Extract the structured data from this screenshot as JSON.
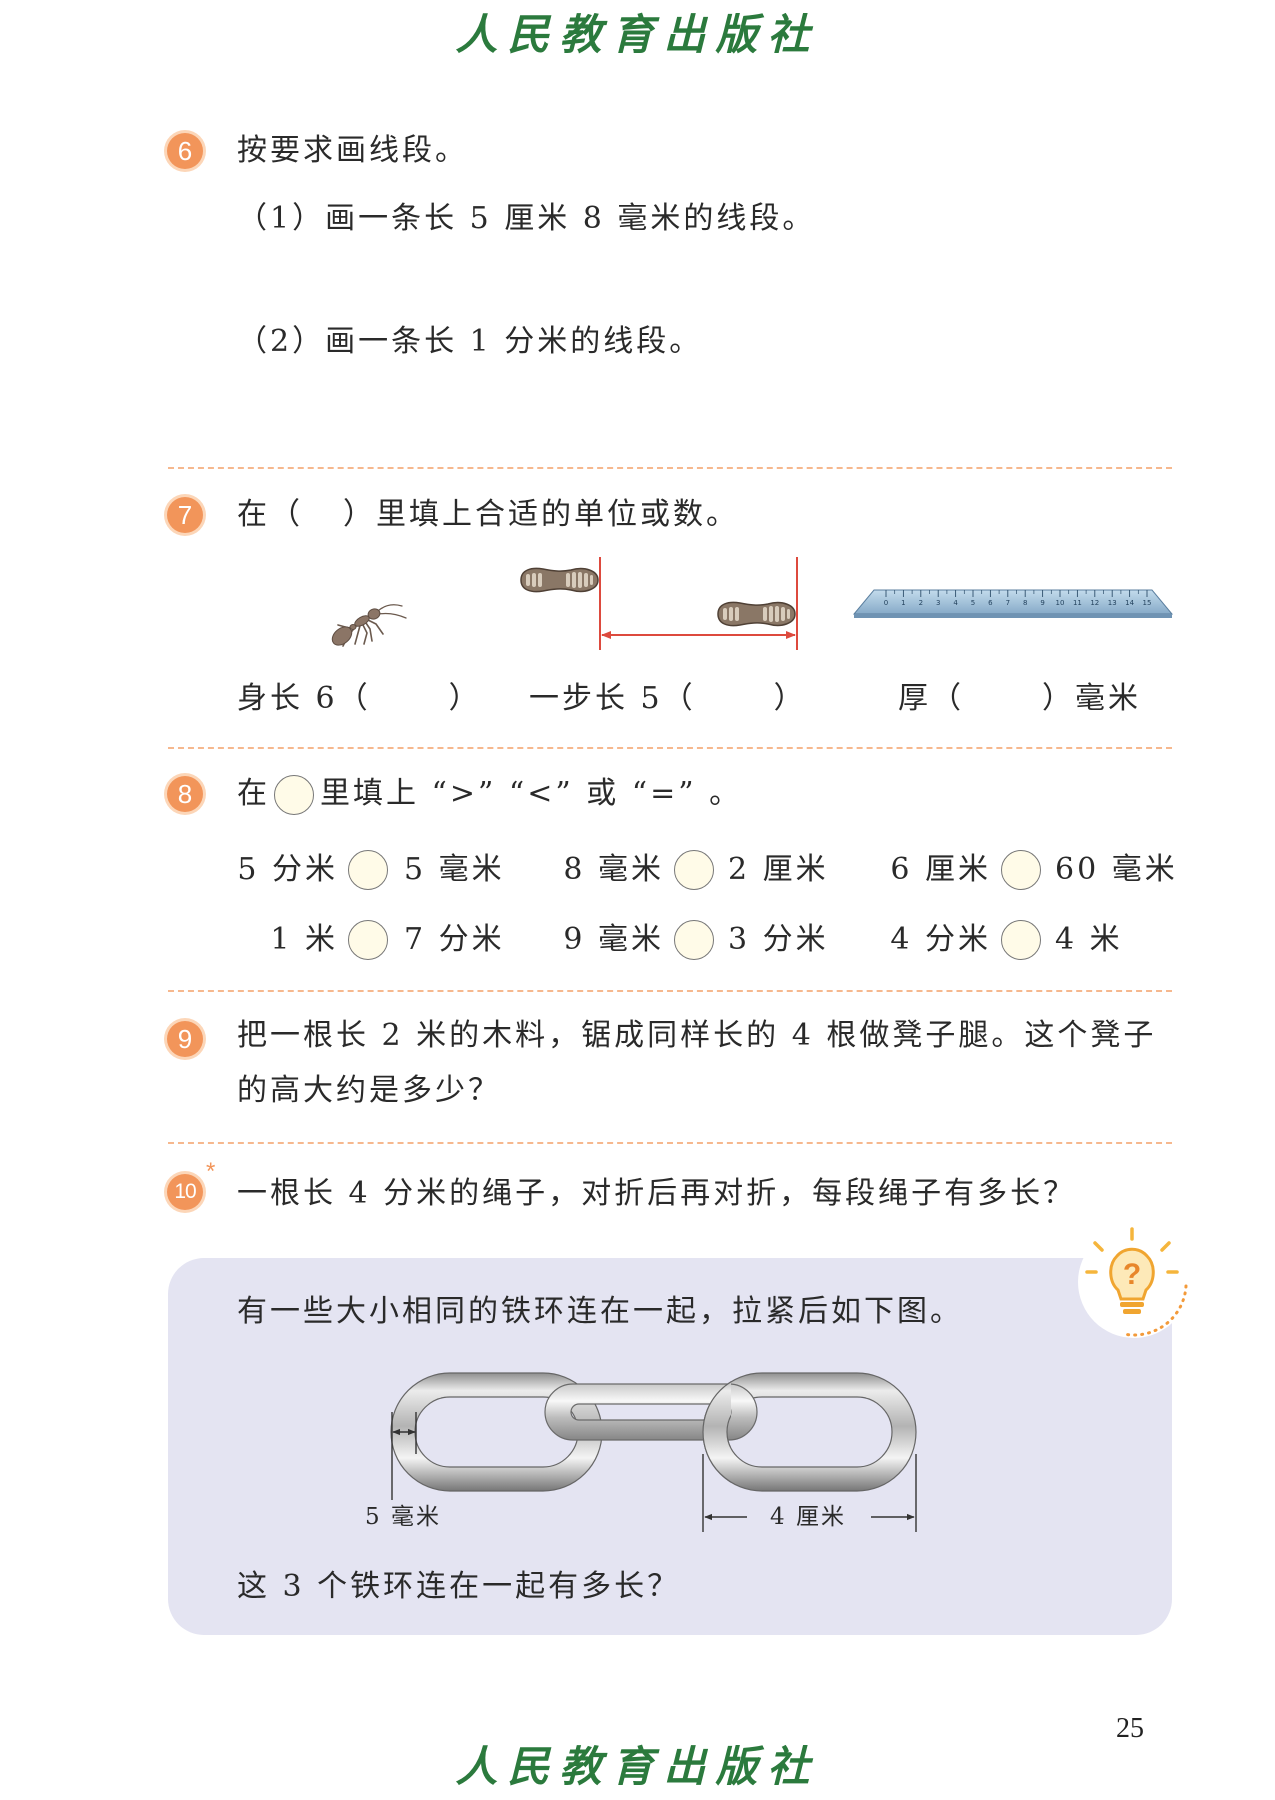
{
  "colors": {
    "accent": "#f2955a",
    "accent_ring": "#fcd6b8",
    "publisher": "#2b7a3d",
    "divider": "#f6b88e",
    "panel": "#e4e4f2",
    "blank_fill": "#fffbe8",
    "arrow": "#dd4a3e"
  },
  "header": {
    "publisher": "人民教育出版社"
  },
  "q6": {
    "number": "6",
    "prompt": "按要求画线段。",
    "parts": [
      {
        "text": "（1）画一条长 5 厘米 8 毫米的线段。"
      },
      {
        "text": "（2）画一条长 1 分米的线段。"
      }
    ]
  },
  "q7": {
    "number": "7",
    "prompt_before": "在（",
    "prompt_after": "）里填上合适的单位或数。",
    "icons": [
      "ant-icon",
      "footprint-icon",
      "ruler-icon"
    ],
    "ruler_labels": [
      "0",
      "1",
      "2",
      "3",
      "4",
      "5",
      "6",
      "7",
      "8",
      "9",
      "10",
      "11",
      "12",
      "13",
      "14",
      "15"
    ],
    "items": [
      {
        "prefix": "身长 6（",
        "suffix": "）"
      },
      {
        "prefix": "一步长 5（",
        "suffix": "）"
      },
      {
        "prefix": "厚（",
        "suffix": "）毫米"
      }
    ]
  },
  "q8": {
    "number": "8",
    "prompt_before": "在",
    "prompt_after": "里填上 “>” “<” 或 “=” 。",
    "comparisons": [
      [
        {
          "left": "5 分米",
          "right": "5 毫米"
        },
        {
          "left": "8 毫米",
          "right": "2 厘米"
        },
        {
          "left": "6 厘米",
          "right": "60 毫米"
        }
      ],
      [
        {
          "left": "1 米",
          "right": "7 分米"
        },
        {
          "left": "9 毫米",
          "right": "3 分米"
        },
        {
          "left": "4 分米",
          "right": "4 米"
        }
      ]
    ]
  },
  "q9": {
    "number": "9",
    "lines": [
      "把一根长 2 米的木料，锯成同样长的 4 根做凳子腿。这个凳子",
      "的高大约是多少？"
    ]
  },
  "q10": {
    "number": "10",
    "marker": "*",
    "text": "一根长 4 分米的绳子，对折后再对折，每段绳子有多长？"
  },
  "challenge": {
    "icons": [
      "lightbulb-question-icon",
      "iron-chain-icon"
    ],
    "question_mark": "?",
    "intro": "有一些大小相同的铁环连在一起，拉紧后如下图。",
    "thickness_label": "5 毫米",
    "length_label": "4 厘米",
    "question": "这 3 个铁环连在一起有多长？"
  },
  "footer": {
    "publisher": "人民教育出版社"
  },
  "page_number": "25"
}
